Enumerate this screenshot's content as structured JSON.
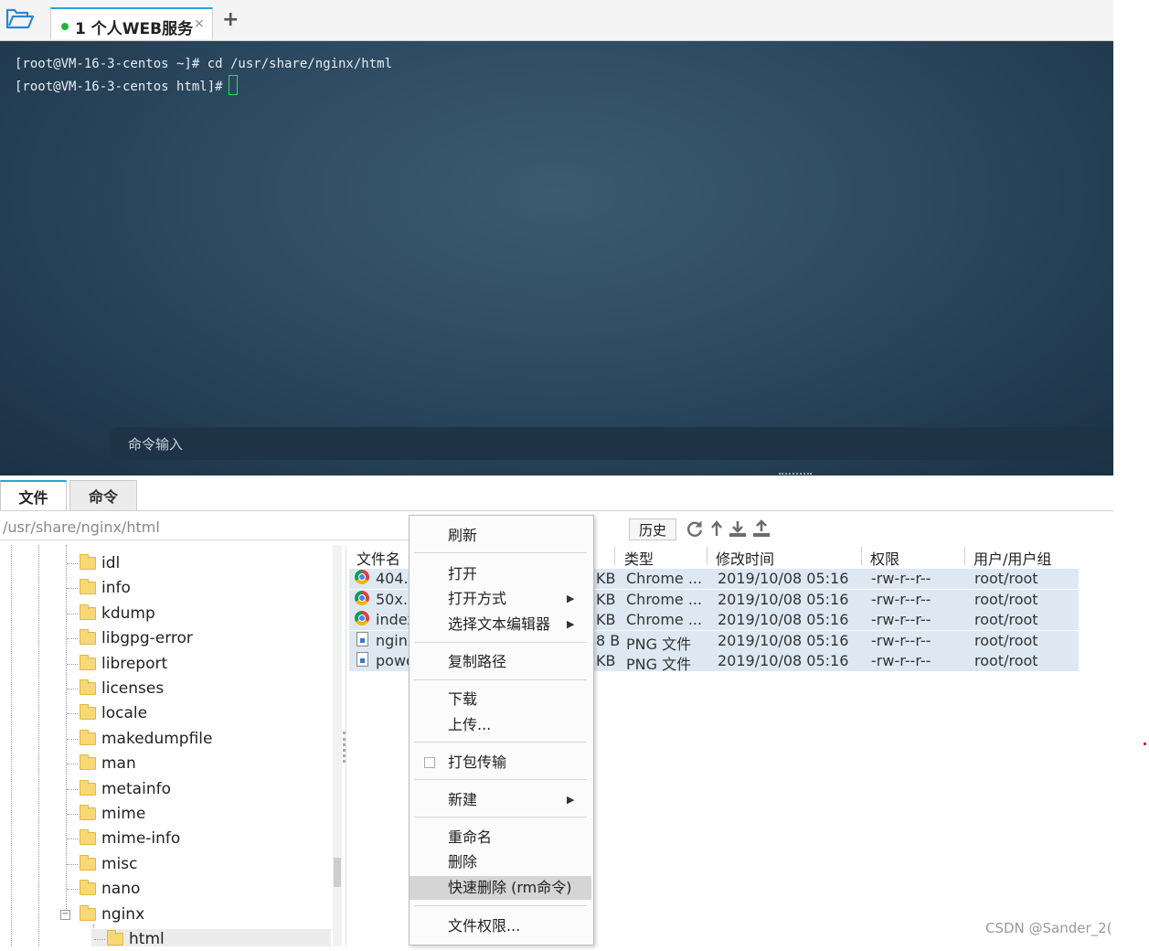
{
  "tabbar": {
    "session_tab": "1 个人WEB服务",
    "close_glyph": "×",
    "add_glyph": "+"
  },
  "terminal": {
    "line1": "[root@VM-16-3-centos ~]# cd /usr/share/nginx/html",
    "line2": "[root@VM-16-3-centos html]#",
    "command_input_placeholder": "命令输入"
  },
  "bottom_tabs": [
    "文件",
    "命令"
  ],
  "pathbar": {
    "path": "/usr/share/nginx/html",
    "history_label": "历史"
  },
  "tree": {
    "items": [
      "idl",
      "info",
      "kdump",
      "libgpg-error",
      "libreport",
      "licenses",
      "locale",
      "makedumpfile",
      "man",
      "metainfo",
      "mime",
      "mime-info",
      "misc",
      "nano",
      "nginx",
      "html"
    ],
    "collapse_glyph": "−"
  },
  "file_list": {
    "columns": [
      "文件名",
      "类型",
      "修改时间",
      "权限",
      "用户/用户组"
    ],
    "rows": [
      {
        "name": "404.h",
        "size": "KB",
        "type": "Chrome ...",
        "modified": "2019/10/08 05:16",
        "perm": "-rw-r--r--",
        "owner": "root/root",
        "icon": "chrome-icon"
      },
      {
        "name": "50x.h",
        "size": "KB",
        "type": "Chrome ...",
        "modified": "2019/10/08 05:16",
        "perm": "-rw-r--r--",
        "owner": "root/root",
        "icon": "chrome-icon"
      },
      {
        "name": "index",
        "size": "KB",
        "type": "Chrome ...",
        "modified": "2019/10/08 05:16",
        "perm": "-rw-r--r--",
        "owner": "root/root",
        "icon": "chrome-icon"
      },
      {
        "name": "nginx",
        "size": "8 B",
        "type": "PNG 文件",
        "modified": "2019/10/08 05:16",
        "perm": "-rw-r--r--",
        "owner": "root/root",
        "icon": "png-file-icon"
      },
      {
        "name": "powe",
        "size": "KB",
        "type": "PNG 文件",
        "modified": "2019/10/08 05:16",
        "perm": "-rw-r--r--",
        "owner": "root/root",
        "icon": "png-file-icon"
      }
    ]
  },
  "context_menu": {
    "refresh": "刷新",
    "open": "打开",
    "open_with": "打开方式",
    "choose_editor": "选择文本编辑器",
    "copy_path": "复制路径",
    "download": "下载",
    "upload": "上传...",
    "pack_transfer": "打包传输",
    "new": "新建",
    "rename": "重命名",
    "delete": "删除",
    "quick_delete": "快速删除 (rm命令)",
    "permissions": "文件权限...",
    "submenu_arrow": "▶"
  },
  "watermark": "CSDN @Sander_2(",
  "colors": {
    "tab_accent": "#2aa3e0",
    "status_dot": "#1fb53d",
    "cursor": "#27e05b",
    "selection": "#dde8f3"
  }
}
